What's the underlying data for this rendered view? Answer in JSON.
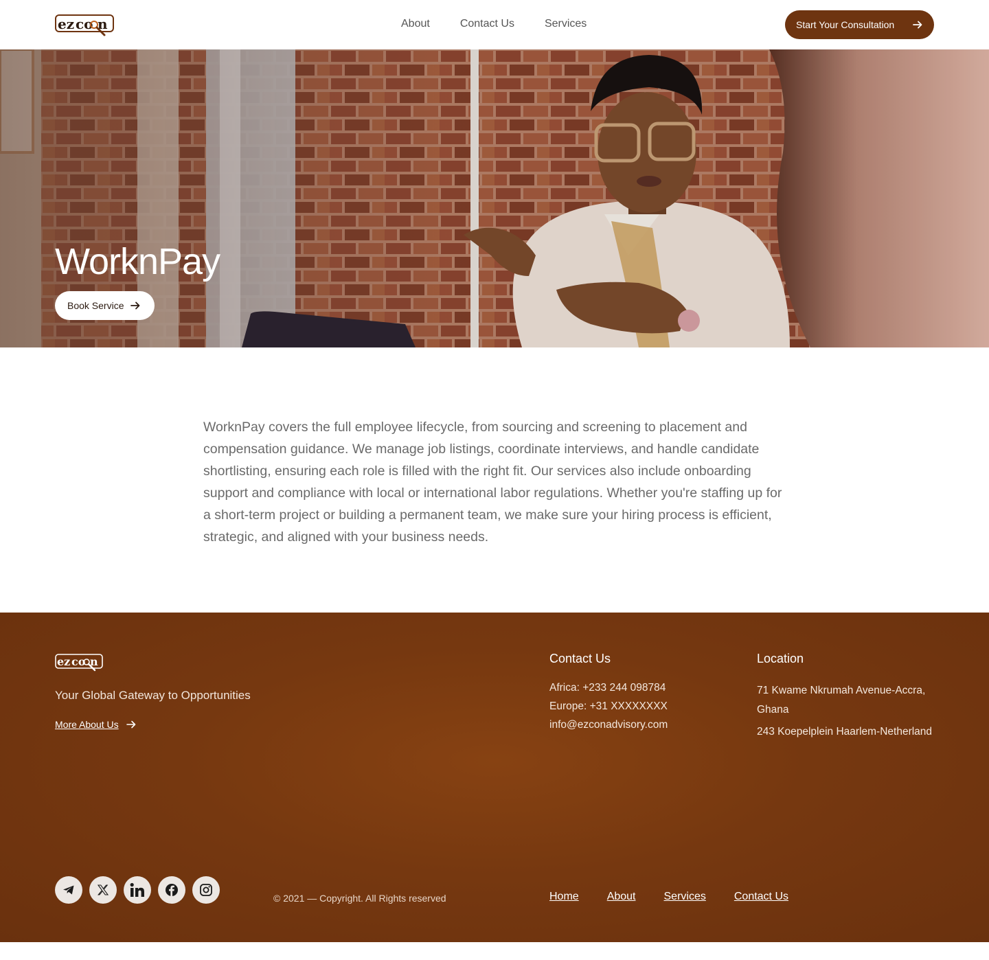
{
  "brand": {
    "name": "ezcon",
    "accent": "#6e3410"
  },
  "nav": {
    "items": [
      "About",
      "Contact Us",
      "Services"
    ]
  },
  "header": {
    "cta_label": "Start Your Consultation"
  },
  "hero": {
    "title": "WorknPay",
    "button_label": "Book Service"
  },
  "main": {
    "description": "WorknPay covers the full employee lifecycle, from sourcing and screening to placement and compensation guidance. We manage job listings, coordinate interviews, and handle candidate shortlisting, ensuring each role is filled with the right fit. Our services also include onboarding support and compliance with local or international labor regulations. Whether you're staffing up for a short-term project or building a permanent team, we make sure your hiring process is efficient, strategic, and aligned with your business needs."
  },
  "footer": {
    "tagline": "Your Global Gateway to  Opportunities",
    "more_label": "More About Us",
    "contact": {
      "heading": "Contact Us",
      "africa": "Africa: +233 244 098784",
      "europe": "Europe: +31 XXXXXXXX",
      "email": "info@ezconadvisory.com"
    },
    "location": {
      "heading": "Location",
      "address1": "71 Kwame Nkrumah Avenue-Accra, Ghana",
      "address2": "243 Koepelplein Haarlem-Netherland"
    },
    "socials": [
      "telegram-icon",
      "x-icon",
      "linkedin-icon",
      "facebook-icon",
      "instagram-icon"
    ],
    "copyright": "© 2021 — Copyright. All Rights reserved",
    "links": [
      "Home",
      "About",
      "Services",
      "Contact Us"
    ]
  }
}
